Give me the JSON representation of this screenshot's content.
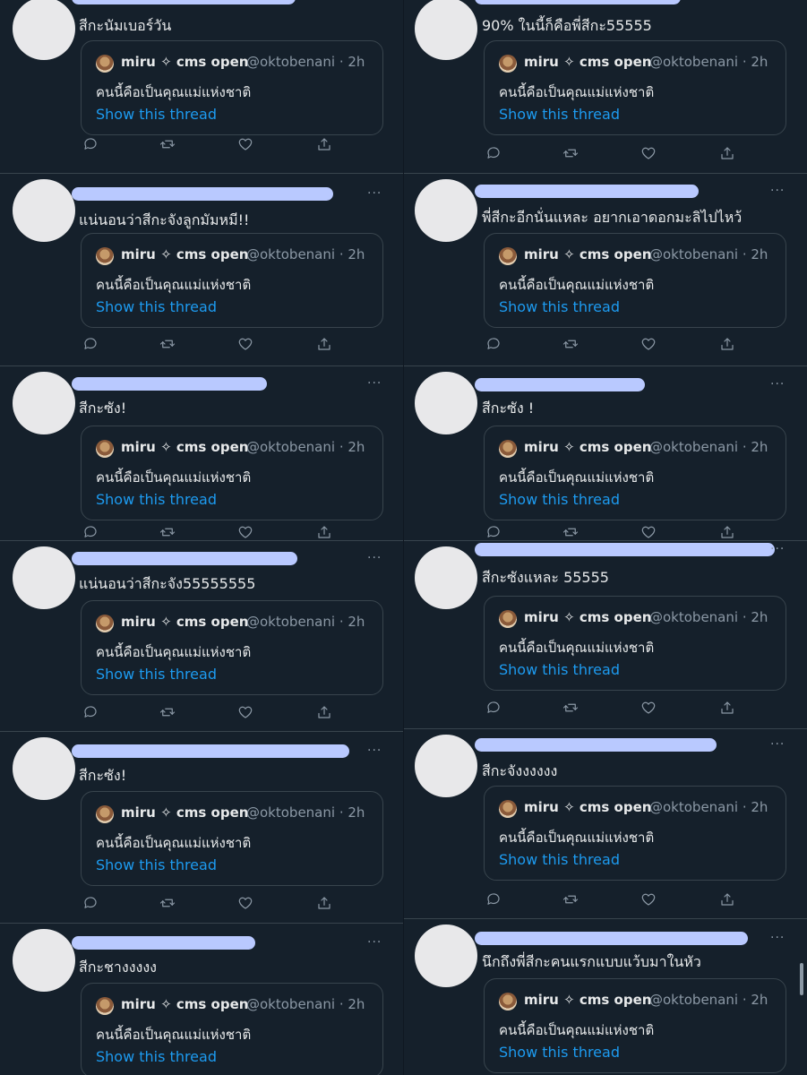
{
  "quoted": {
    "author_name": "miru ✧ cms open",
    "author_handle": "@oktobenani",
    "time": "· 2h",
    "text": "คนนี้คือเป็นคุณแม่แห่งชาติ",
    "link": "Show this thread"
  },
  "more_label": "···",
  "left_column": [
    {
      "text": "สีกะนัมเบอร์วัน"
    },
    {
      "text": "แน่นอนว่าสีกะจังลูกมัมหมี!!"
    },
    {
      "text": "สีกะซัง!"
    },
    {
      "text": "แน่นอนว่าสีกะจัง55555555"
    },
    {
      "text": "สีกะซัง!"
    },
    {
      "text": "สีกะชางงงงง"
    }
  ],
  "right_column": [
    {
      "text": "90% ในนี้ก็คือพี่สีกะ55555"
    },
    {
      "text": "พี่สีกะอีกนั่นแหละ อยากเอาดอกมะลิไปไหว้"
    },
    {
      "text": "สีกะซัง !"
    },
    {
      "text": "สีกะซังแหละ 55555"
    },
    {
      "text": "สีกะจังงงงงง"
    },
    {
      "text": "นึกถึงพี่สีกะคนแรกแบบแว้บมาในหัว"
    }
  ],
  "icons": [
    "reply-icon",
    "retweet-icon",
    "like-icon",
    "share-icon"
  ],
  "colors": {
    "background": "#15202b",
    "link": "#1d9bf0",
    "muted": "#8b98a5",
    "border": "#38444d"
  }
}
